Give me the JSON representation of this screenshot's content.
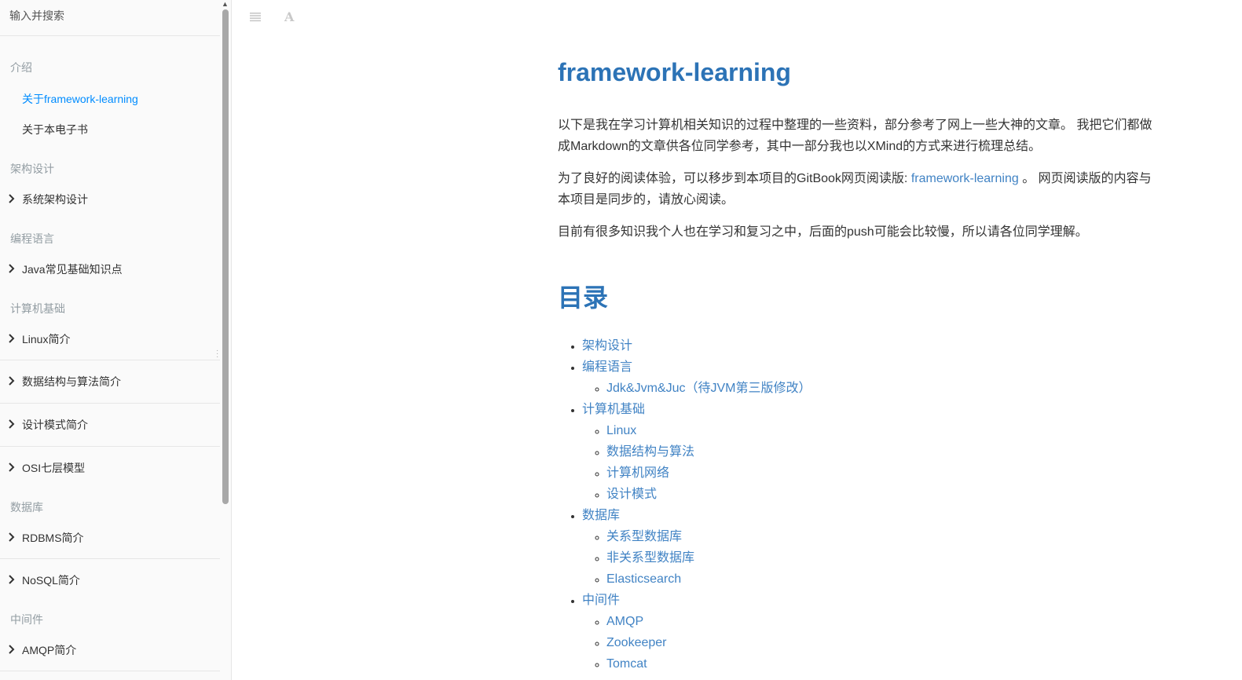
{
  "sidebar": {
    "search_placeholder": "输入并搜索",
    "sections": {
      "intro": "介绍",
      "arch": "架构设计",
      "lang": "编程语言",
      "cs": "计算机基础",
      "db": "数据库",
      "mw": "中间件"
    },
    "items": {
      "about_framework": "关于framework-learning",
      "about_ebook": "关于本电子书",
      "system_arch": "系统架构设计",
      "java_basics": "Java常见基础知识点",
      "linux": "Linux简介",
      "dsa": "数据结构与算法简介",
      "design_patterns": "设计模式简介",
      "osi": "OSI七层模型",
      "rdbms": "RDBMS简介",
      "nosql": "NoSQL简介",
      "amqp": "AMQP简介"
    }
  },
  "toolbar": {
    "toc_icon": "menu-lines-icon",
    "font_icon": "font-settings-icon",
    "font_glyph": "A"
  },
  "article": {
    "title": "framework-learning",
    "p1": "以下是我在学习计算机相关知识的过程中整理的一些资料，部分参考了网上一些大神的文章。 我把它们都做成Markdown的文章供各位同学参考，其中一部分我也以XMind的方式来进行梳理总结。",
    "p2_before": "为了良好的阅读体验，可以移步到本项目的GitBook网页阅读版: ",
    "p2_link": "framework-learning",
    "p2_after": " 。 网页阅读版的内容与本项目是同步的，请放心阅读。",
    "p3": "目前有很多知识我个人也在学习和复习之中，后面的push可能会比较慢，所以请各位同学理解。",
    "toc_heading": "目录",
    "toc": {
      "arch": "架构设计",
      "lang": "编程语言",
      "jdk": "Jdk&Jvm&Juc（待JVM第三版修改）",
      "cs": "计算机基础",
      "linux": "Linux",
      "dsa": "数据结构与算法",
      "network": "计算机网络",
      "patterns": "设计模式",
      "db": "数据库",
      "relational": "关系型数据库",
      "nonrelational": "非关系型数据库",
      "es": "Elasticsearch",
      "mw": "中间件",
      "amqp": "AMQP",
      "zk": "Zookeeper",
      "tomcat": "Tomcat"
    }
  }
}
